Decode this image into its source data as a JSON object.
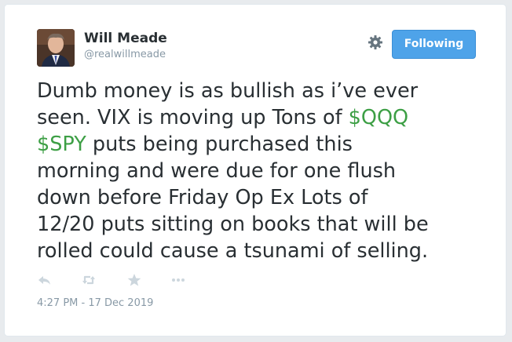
{
  "user": {
    "name": "Will Meade",
    "handle": "@realwillmeade"
  },
  "follow_button": {
    "label": "Following"
  },
  "tweet": {
    "lines": [
      [
        {
          "text": "Dumb money is as bullish as i’ve ever",
          "cashtag": false
        }
      ],
      [
        {
          "text": "seen. VIX is moving up Tons of ",
          "cashtag": false
        },
        {
          "text": "$QQQ",
          "cashtag": true
        }
      ],
      [
        {
          "text": "$SPY",
          "cashtag": true
        },
        {
          "text": " puts being purchased this",
          "cashtag": false
        }
      ],
      [
        {
          "text": "morning and were due for one flush",
          "cashtag": false
        }
      ],
      [
        {
          "text": "down before Friday Op Ex Lots of",
          "cashtag": false
        }
      ],
      [
        {
          "text": "12/20 puts sitting on books that will be",
          "cashtag": false
        }
      ],
      [
        {
          "text": "rolled could cause a tsunami of selling.",
          "cashtag": false
        }
      ]
    ]
  },
  "actions": [
    {
      "name": "reply-icon"
    },
    {
      "name": "retweet-icon"
    },
    {
      "name": "like-star-icon"
    },
    {
      "name": "more-icon"
    }
  ],
  "timestamp": "4:27 PM - 17 Dec 2019",
  "colors": {
    "cashtag": "#3d9f45",
    "button": "#4ea3e9",
    "text": "#292f33",
    "muted": "#8899a6"
  }
}
